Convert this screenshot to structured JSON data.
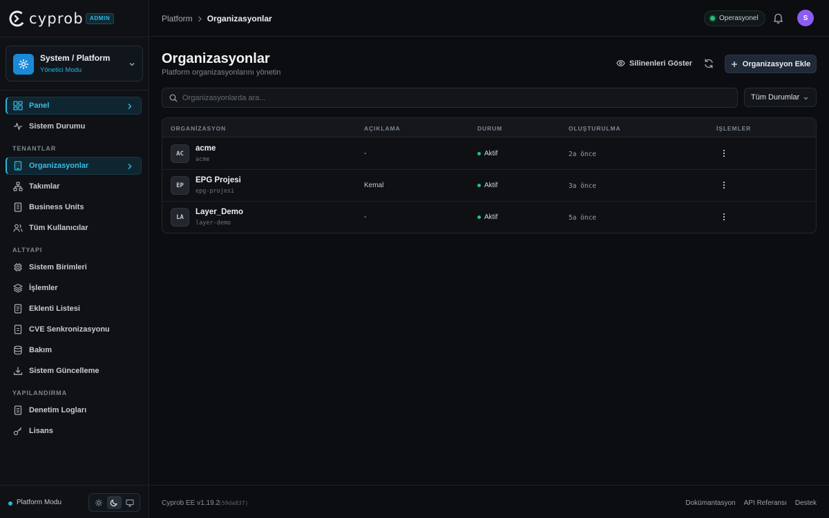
{
  "brand": {
    "name": "cyprob",
    "badge": "ADMIN"
  },
  "context": {
    "title": "System / Platform",
    "subtitle": "Yönetici Modu"
  },
  "sidebar": {
    "top_items": [
      {
        "label": "Panel",
        "icon": "dashboard-icon",
        "active": true
      },
      {
        "label": "Sistem Durumu",
        "icon": "activity-icon"
      }
    ],
    "sections": [
      {
        "title": "TENANTLAR",
        "items": [
          {
            "label": "Organizasyonlar",
            "icon": "building-icon",
            "active": true
          },
          {
            "label": "Takımlar",
            "icon": "network-icon"
          },
          {
            "label": "Business Units",
            "icon": "office-building-icon"
          },
          {
            "label": "Tüm Kullanıcılar",
            "icon": "users-icon"
          }
        ]
      },
      {
        "title": "ALTYAPI",
        "items": [
          {
            "label": "Sistem Birimleri",
            "icon": "cpu-icon"
          },
          {
            "label": "İşlemler",
            "icon": "layers-icon"
          },
          {
            "label": "Eklenti Listesi",
            "icon": "file-list-icon"
          },
          {
            "label": "CVE Senkronizasyonu",
            "icon": "sync-icon"
          },
          {
            "label": "Bakım",
            "icon": "database-icon"
          },
          {
            "label": "Sistem Güncelleme",
            "icon": "download-icon"
          }
        ]
      },
      {
        "title": "YAPILANDIRMA",
        "items": [
          {
            "label": "Denetim Logları",
            "icon": "log-icon"
          },
          {
            "label": "Lisans",
            "icon": "key-icon"
          }
        ]
      }
    ],
    "footer": {
      "mode_label": "Platform Modu",
      "theme_selected": "dark"
    }
  },
  "topbar": {
    "breadcrumb": [
      "Platform",
      "Organizasyonlar"
    ],
    "status": "Operasyonel",
    "avatar_initial": "S",
    "avatar_color": "#8b5cf6"
  },
  "main": {
    "title": "Organizasyonlar",
    "subtitle": "Platform organizasyonlarını yönetin",
    "show_deleted_label": "Silinenleri Göster",
    "add_label": "Organizasyon Ekle",
    "search_placeholder": "Organizasyonlarda ara...",
    "status_filter": "Tüm Durumlar",
    "columns": [
      "ORGANİZASYON",
      "AÇIKLAMA",
      "DURUM",
      "OLUŞTURULMA",
      "İŞLEMLER"
    ],
    "rows": [
      {
        "initials": "AC",
        "name": "acme",
        "slug": "acme",
        "description": "-",
        "status": "Aktif",
        "created": "2a önce"
      },
      {
        "initials": "EP",
        "name": "EPG Projesi",
        "slug": "epg-projesi",
        "description": "Kemal",
        "status": "Aktif",
        "created": "3a önce"
      },
      {
        "initials": "LA",
        "name": "Layer_Demo",
        "slug": "layer-demo",
        "description": "-",
        "status": "Aktif",
        "created": "5a önce"
      }
    ]
  },
  "footer": {
    "version": "Cyprob EE v1.19.2",
    "hash": "(59da837)",
    "links": [
      "Dokümantasyon",
      "API Referansı",
      "Destek"
    ]
  },
  "colors": {
    "accent": "#2cb6e3",
    "success": "#22c483",
    "background": "#0b0d11"
  }
}
